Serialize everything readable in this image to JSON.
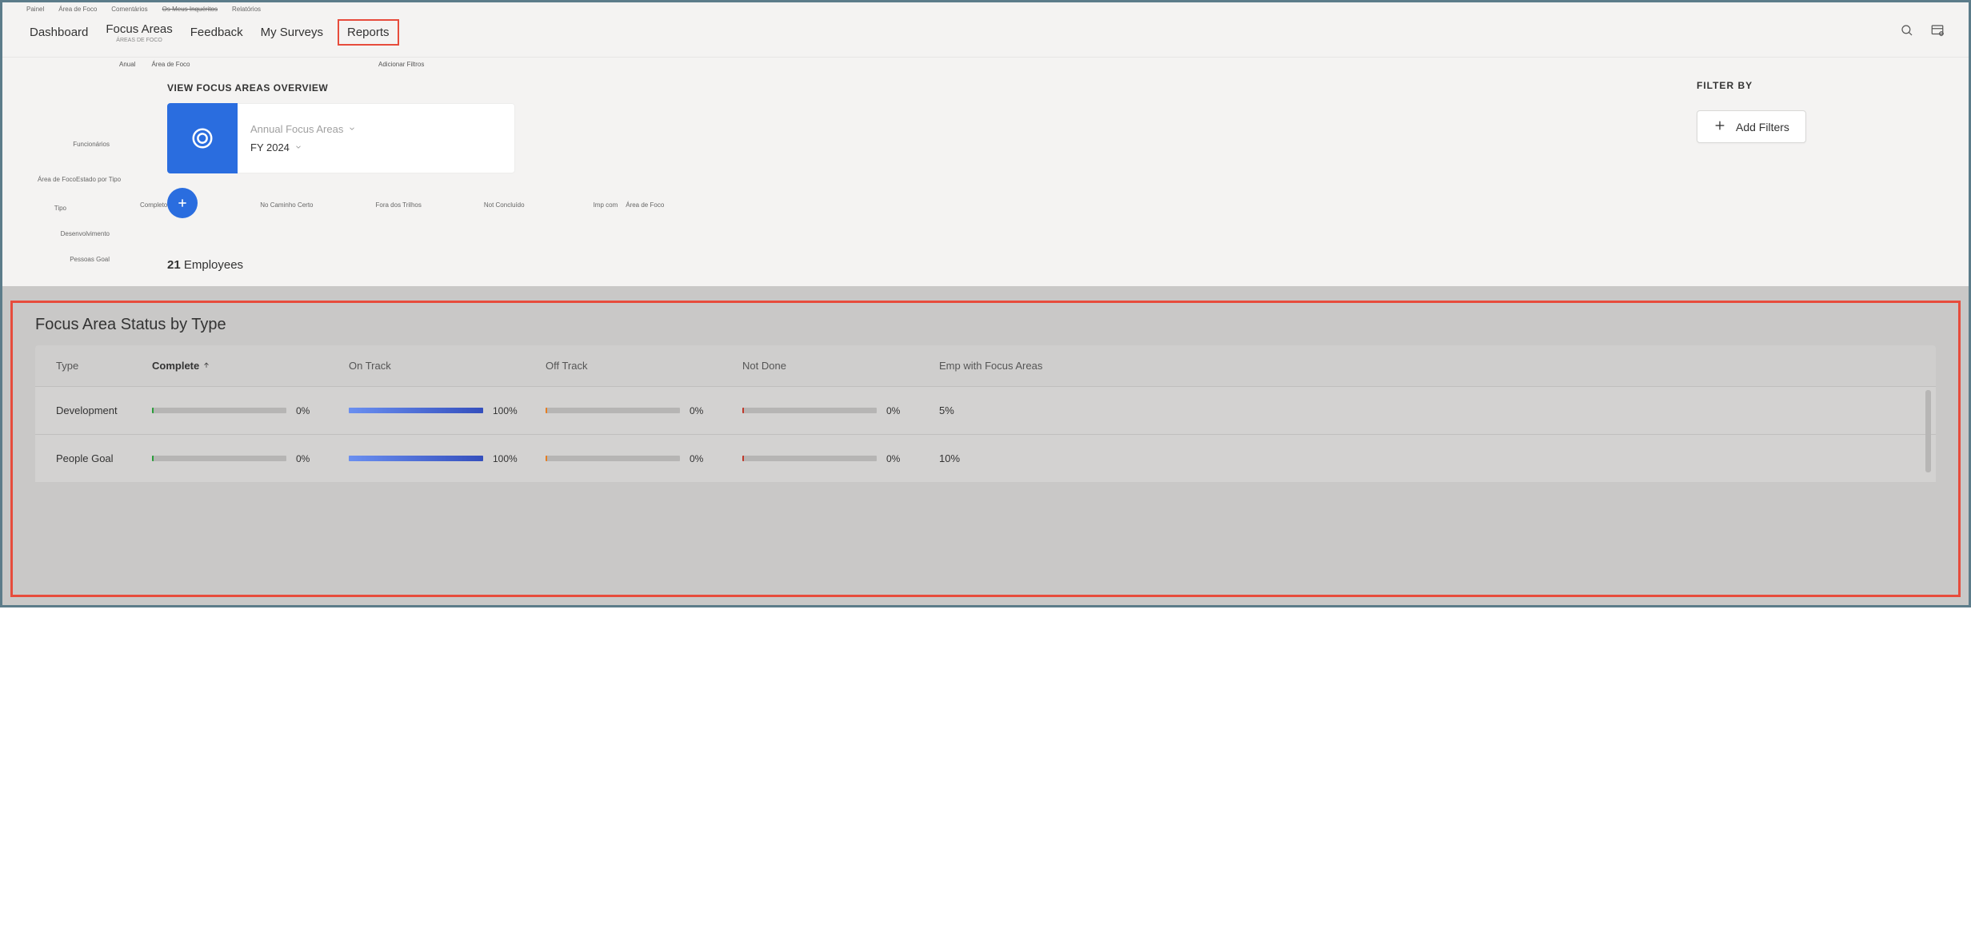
{
  "top_meta": {
    "painel": "Painel",
    "area_foco": "Área de Foco",
    "comentarios": "Comentários",
    "inqueritos": "Os Meus Inquéritos",
    "relatorios": "Relatórios"
  },
  "nav": {
    "dashboard": "Dashboard",
    "focus_areas": "Focus Areas",
    "focus_areas_sub": "ÁREAS DE FOCO",
    "feedback": "Feedback",
    "my_surveys": "My Surveys",
    "reports": "Reports"
  },
  "mid": {
    "tiny_anual": "Anual",
    "tiny_area": "Área de Foco",
    "tiny_add_filters": "Adicionar Filtros",
    "overview_title": "VIEW FOCUS AREAS OVERVIEW",
    "card_line1": "Annual Focus Areas",
    "card_line2": "FY 2024",
    "left_labels": {
      "funcionarios": "Funcionários",
      "area_foco": "Área de Foco",
      "estado_tipo": "Estado por Tipo",
      "tipo": "Tipo",
      "desenvolvimento": "Desenvolvimento",
      "pessoas_goal": "Pessoas Goal"
    },
    "legend": {
      "completo": "Completo",
      "no_caminho": "No Caminho Certo",
      "fora_trilhos": "Fora dos Trilhos",
      "not_done": "Not Concluído",
      "imp_com": "Imp com",
      "area_foco": "Área de Foco"
    },
    "emp_count_num": "21",
    "emp_count_label": " Employees"
  },
  "filter": {
    "title": "FILTER BY",
    "add_btn": "Add Filters"
  },
  "section": {
    "title": "Focus Area Status by Type",
    "head": {
      "type": "Type",
      "complete": "Complete",
      "on_track": "On Track",
      "off_track": "Off Track",
      "not_done": "Not Done",
      "emp_with": "Emp with Focus Areas"
    },
    "rows": {
      "r0": {
        "label": "Development",
        "complete_pct": "0%",
        "on_track_pct": "100%",
        "off_track_pct": "0%",
        "not_done_pct": "0%",
        "emp_pct": "5%"
      },
      "r1": {
        "label": "People Goal",
        "complete_pct": "0%",
        "on_track_pct": "100%",
        "off_track_pct": "0%",
        "not_done_pct": "0%",
        "emp_pct": "10%"
      }
    }
  },
  "chart_data": {
    "type": "table",
    "title": "Focus Area Status by Type",
    "columns": [
      "Type",
      "Complete",
      "On Track",
      "Off Track",
      "Not Done",
      "Emp with Focus Areas"
    ],
    "rows": [
      {
        "Type": "Development",
        "Complete": 0,
        "On Track": 100,
        "Off Track": 0,
        "Not Done": 0,
        "Emp with Focus Areas": 5
      },
      {
        "Type": "People Goal",
        "Complete": 0,
        "On Track": 100,
        "Off Track": 0,
        "Not Done": 0,
        "Emp with Focus Areas": 10
      }
    ],
    "units": "percent",
    "sort": {
      "column": "Complete",
      "direction": "asc"
    }
  }
}
